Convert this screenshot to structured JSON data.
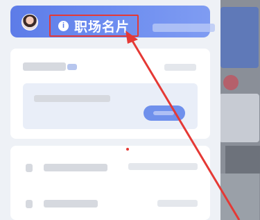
{
  "header": {
    "badge_icon": "i",
    "title": "职场名片"
  },
  "colors": {
    "header_blue": "#5d7ce8",
    "annotation_red": "#e53935"
  },
  "icons": {
    "avatar": "avatar",
    "badge": "info-circle-icon"
  }
}
